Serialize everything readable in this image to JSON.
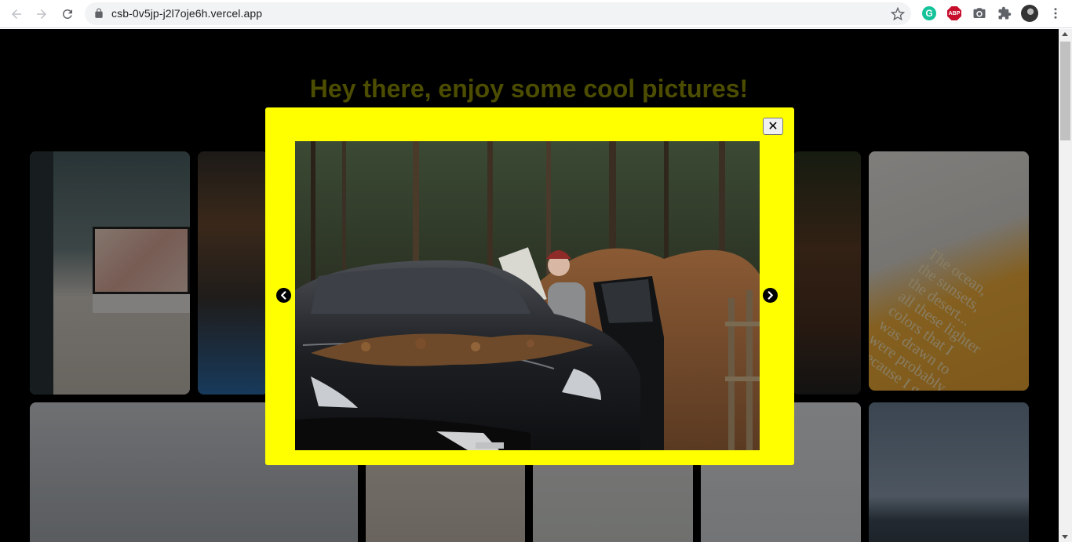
{
  "browser": {
    "url": "csb-0v5jp-j2l7oje6h.vercel.app",
    "icons": {
      "back": "back-arrow-icon",
      "forward": "forward-arrow-icon",
      "reload": "reload-icon",
      "lock": "lock-icon",
      "bookmark": "star-icon",
      "grammarly": "grammarly-icon",
      "adblock": "adblock-icon",
      "camera": "camera-icon",
      "extensions": "puzzle-icon",
      "menu": "kebab-menu-icon"
    },
    "extensions": {
      "grammarly_letter": "G",
      "adblock_label": "ABP"
    }
  },
  "page": {
    "title": "Hey there, enjoy some cool pictures!",
    "background": "#000000",
    "title_color": "#4d4d00",
    "gallery_tile_count": 10,
    "book_text": "The ocean,\nthe sunsets,\nthe desert...\nall these lighter\ncolors that I\nwas drawn to\nwere probably\nbecause I grew"
  },
  "lightbox": {
    "background": "#ffff00",
    "close_label": "✕",
    "prev_icon": "chevron-left-icon",
    "next_icon": "chevron-right-icon",
    "photo_subject": "woman with map beside black car in autumn forest"
  }
}
